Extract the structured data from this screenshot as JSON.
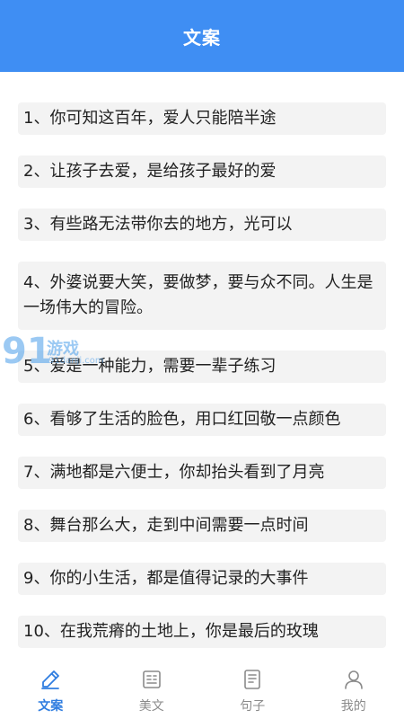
{
  "header": {
    "title": "文案"
  },
  "items": [
    "1、你可知这百年，爱人只能陪半途",
    "2、让孩子去爱，是给孩子最好的爱",
    "3、有些路无法带你去的地方，光可以",
    "4、外婆说要大笑，要做梦，要与众不同。人生是一场伟大的冒险。",
    "5、爱是一种能力，需要一辈子练习",
    "6、看够了生活的脸色，用口红回敬一点颜色",
    "7、满地都是六便士，你却抬头看到了月亮",
    "8、舞台那么大，走到中间需要一点时间",
    "9、你的小生活，都是值得记录的大事件",
    "10、在我荒瘠的土地上，你是最后的玫瑰"
  ],
  "watermark": {
    "number": "91",
    "name": "游戏",
    "url": "91danji.com"
  },
  "tabs": [
    {
      "label": "文案",
      "icon": "pen-icon",
      "active": true
    },
    {
      "label": "美文",
      "icon": "article-icon",
      "active": false
    },
    {
      "label": "句子",
      "icon": "document-icon",
      "active": false
    },
    {
      "label": "我的",
      "icon": "person-icon",
      "active": false
    }
  ],
  "colors": {
    "accent": "#3f8ef3",
    "active_tab": "#2f7de0",
    "inactive_tab": "#8a8a8a",
    "card_bg": "#f3f3f3"
  }
}
